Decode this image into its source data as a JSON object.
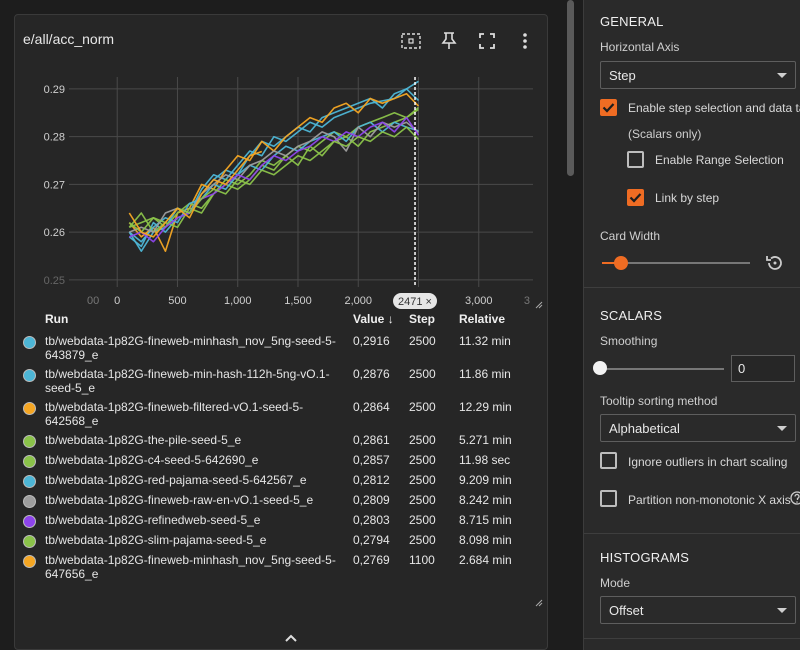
{
  "card": {
    "title": "e/all/acc_norm",
    "tools": [
      "fit-domain-icon",
      "pin-icon",
      "fullscreen-icon",
      "more-vert-icon"
    ]
  },
  "chart_data": {
    "type": "line",
    "x_ticks": [
      "00",
      "0",
      "500",
      "1,000",
      "1,500",
      "2,000",
      "2,500",
      "3,000",
      "3"
    ],
    "y_ticks": [
      "0.29",
      "0.28",
      "0.27",
      "0.26",
      "0.25"
    ],
    "xlim": [
      -400,
      3450
    ],
    "ylim": [
      0.2485,
      0.2925
    ],
    "grid": true,
    "cursor": {
      "step": 2471,
      "label": "2471 ×"
    },
    "x": [
      100,
      200,
      300,
      400,
      500,
      600,
      700,
      800,
      900,
      1000,
      1100,
      1200,
      1300,
      1400,
      1500,
      1600,
      1700,
      1800,
      1900,
      2000,
      2100,
      2200,
      2300,
      2400,
      2500
    ],
    "series": [
      {
        "name": "tb/webdata-1p82G-fineweb-minhash_nov_5ng-seed-5-643879_e",
        "color": "#4db6d6",
        "values": [
          0.259,
          0.257,
          0.262,
          0.26,
          0.263,
          0.264,
          0.269,
          0.272,
          0.271,
          0.274,
          0.277,
          0.276,
          0.28,
          0.279,
          0.281,
          0.283,
          0.282,
          0.284,
          0.285,
          0.286,
          0.287,
          0.2875,
          0.288,
          0.29,
          0.2916
        ]
      },
      {
        "name": "tb/webdata-1p82G-fineweb-min-hash-112h-5ng-vO.1-seed-5_e",
        "color": "#4db6d6",
        "values": [
          0.26,
          0.256,
          0.26,
          0.261,
          0.265,
          0.264,
          0.268,
          0.271,
          0.273,
          0.272,
          0.276,
          0.279,
          0.278,
          0.28,
          0.282,
          0.281,
          0.284,
          0.285,
          0.286,
          0.287,
          0.288,
          0.286,
          0.289,
          0.29,
          0.2876
        ]
      },
      {
        "name": "tb/webdata-1p82G-fineweb-filtered-vO.1-seed-5-642568_e",
        "color": "#f5a623",
        "values": [
          0.262,
          0.259,
          0.261,
          0.256,
          0.264,
          0.265,
          0.27,
          0.269,
          0.273,
          0.276,
          0.275,
          0.279,
          0.277,
          0.28,
          0.282,
          0.284,
          0.283,
          0.286,
          0.287,
          0.285,
          0.288,
          0.287,
          0.288,
          0.289,
          0.2864
        ]
      },
      {
        "name": "tb/webdata-1p82G-the-pile-seed-5_e",
        "color": "#8bc34a",
        "values": [
          0.261,
          0.264,
          0.26,
          0.262,
          0.261,
          0.265,
          0.264,
          0.268,
          0.27,
          0.269,
          0.271,
          0.274,
          0.273,
          0.276,
          0.274,
          0.278,
          0.276,
          0.279,
          0.28,
          0.278,
          0.281,
          0.282,
          0.283,
          0.284,
          0.2861
        ]
      },
      {
        "name": "tb/webdata-1p82G-c4-seed-5-642690_e",
        "color": "#8bc34a",
        "values": [
          0.261,
          0.262,
          0.263,
          0.261,
          0.264,
          0.266,
          0.265,
          0.268,
          0.271,
          0.27,
          0.272,
          0.275,
          0.274,
          0.276,
          0.278,
          0.277,
          0.279,
          0.281,
          0.28,
          0.282,
          0.283,
          0.284,
          0.285,
          0.284,
          0.2857
        ]
      },
      {
        "name": "tb/webdata-1p82G-red-pajama-seed-5-642567_e",
        "color": "#4db6d6",
        "values": [
          0.26,
          0.258,
          0.261,
          0.263,
          0.262,
          0.266,
          0.267,
          0.27,
          0.269,
          0.272,
          0.274,
          0.273,
          0.276,
          0.278,
          0.277,
          0.279,
          0.28,
          0.281,
          0.279,
          0.282,
          0.283,
          0.281,
          0.283,
          0.282,
          0.2812
        ]
      },
      {
        "name": "tb/webdata-1p82G-fineweb-raw-en-vO.1-seed-5_e",
        "color": "#9e9e9e",
        "values": [
          0.26,
          0.261,
          0.26,
          0.264,
          0.265,
          0.264,
          0.268,
          0.27,
          0.272,
          0.271,
          0.274,
          0.275,
          0.277,
          0.276,
          0.278,
          0.279,
          0.281,
          0.28,
          0.277,
          0.282,
          0.28,
          0.283,
          0.282,
          0.283,
          0.2809
        ]
      },
      {
        "name": "tb/webdata-1p82G-refinedweb-seed-5_e",
        "color": "#8e44ec",
        "values": [
          0.259,
          0.26,
          0.258,
          0.261,
          0.263,
          0.264,
          0.267,
          0.268,
          0.27,
          0.272,
          0.271,
          0.274,
          0.276,
          0.275,
          0.277,
          0.278,
          0.28,
          0.279,
          0.281,
          0.28,
          0.282,
          0.283,
          0.281,
          0.284,
          0.2803
        ]
      },
      {
        "name": "tb/webdata-1p82G-slim-pajama-seed-5_e",
        "color": "#8bc34a",
        "values": [
          0.262,
          0.26,
          0.263,
          0.262,
          0.265,
          0.264,
          0.267,
          0.269,
          0.268,
          0.271,
          0.27,
          0.273,
          0.272,
          0.274,
          0.276,
          0.275,
          0.277,
          0.279,
          0.278,
          0.28,
          0.279,
          0.281,
          0.28,
          0.282,
          0.2794
        ]
      },
      {
        "name": "tb/webdata-1p82G-fineweb-minhash_nov_5ng-seed-5-647656_e",
        "color": "#f5a623",
        "values": [
          0.264,
          0.26,
          0.259,
          0.262,
          0.265,
          0.263,
          0.268,
          0.271,
          0.27,
          0.273,
          0.276,
          0.2769
        ]
      }
    ]
  },
  "table": {
    "headers": {
      "run": "Run",
      "value": "Value",
      "value_sort": "↓",
      "step": "Step",
      "relative": "Relative"
    },
    "rows": [
      {
        "run": "tb/webdata-1p82G-fineweb-minhash_nov_5ng-seed-5-643879_e",
        "value": "0,2916",
        "step": "2500",
        "relative": "11.32 min",
        "color": "#4db6d6"
      },
      {
        "run": "tb/webdata-1p82G-fineweb-min-hash-112h-5ng-vO.1-seed-5_e",
        "value": "0,2876",
        "step": "2500",
        "relative": "11.86 min",
        "color": "#4db6d6"
      },
      {
        "run": "tb/webdata-1p82G-fineweb-filtered-vO.1-seed-5-642568_e",
        "value": "0,2864",
        "step": "2500",
        "relative": "12.29 min",
        "color": "#f5a623"
      },
      {
        "run": "tb/webdata-1p82G-the-pile-seed-5_e",
        "value": "0,2861",
        "step": "2500",
        "relative": "5.271 min",
        "color": "#8bc34a"
      },
      {
        "run": "tb/webdata-1p82G-c4-seed-5-642690_e",
        "value": "0,2857",
        "step": "2500",
        "relative": "11.98 sec",
        "color": "#8bc34a"
      },
      {
        "run": "tb/webdata-1p82G-red-pajama-seed-5-642567_e",
        "value": "0,2812",
        "step": "2500",
        "relative": "9.209 min",
        "color": "#4db6d6"
      },
      {
        "run": "tb/webdata-1p82G-fineweb-raw-en-vO.1-seed-5_e",
        "value": "0,2809",
        "step": "2500",
        "relative": "8.242 min",
        "color": "#9e9e9e"
      },
      {
        "run": "tb/webdata-1p82G-refinedweb-seed-5_e",
        "value": "0,2803",
        "step": "2500",
        "relative": "8.715 min",
        "color": "#8e44ec"
      },
      {
        "run": "tb/webdata-1p82G-slim-pajama-seed-5_e",
        "value": "0,2794",
        "step": "2500",
        "relative": "8.098 min",
        "color": "#8bc34a"
      },
      {
        "run": "tb/webdata-1p82G-fineweb-minhash_nov_5ng-seed-5-647656_e",
        "value": "0,2769",
        "step": "1100",
        "relative": "2.684 min",
        "color": "#f5a623"
      }
    ]
  },
  "panel": {
    "general": {
      "title": "GENERAL",
      "horizontal_axis_label": "Horizontal Axis",
      "horizontal_axis_value": "Step",
      "step_selection_label": "Enable step selection and data table",
      "step_selection_checked": true,
      "scalars_only": "(Scalars only)",
      "range_selection_label": "Enable Range Selection",
      "range_selection_checked": false,
      "link_by_step_label": "Link by step",
      "link_by_step_checked": true,
      "card_width_label": "Card Width",
      "card_width_fraction": 0.13
    },
    "scalars": {
      "title": "SCALARS",
      "smoothing_label": "Smoothing",
      "smoothing_value": "0",
      "smoothing_fraction": 0,
      "tooltip_sort_label": "Tooltip sorting method",
      "tooltip_sort_value": "Alphabetical",
      "ignore_outliers_label": "Ignore outliers in chart scaling",
      "ignore_outliers_checked": false,
      "partition_label": "Partition non-monotonic X axis",
      "partition_checked": false
    },
    "histograms": {
      "title": "HISTOGRAMS",
      "mode_label": "Mode",
      "mode_value": "Offset"
    },
    "accent": "#ef6c23"
  }
}
